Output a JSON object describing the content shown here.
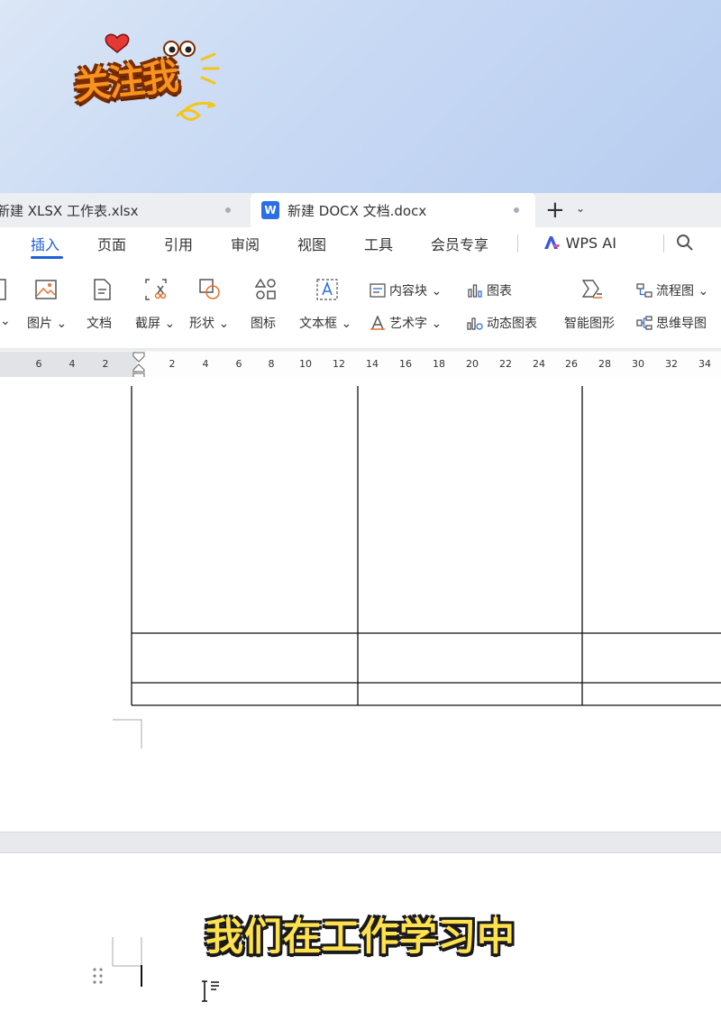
{
  "sticker": {
    "text": "关注我"
  },
  "tabs": [
    {
      "label": "新建 XLSX 工作表.xlsx",
      "active": false
    },
    {
      "label": "新建 DOCX 文档.docx",
      "active": true,
      "icon": "word-icon",
      "icon_text": "W"
    }
  ],
  "tab_actions": {
    "new_tab": "+",
    "more": "⌄"
  },
  "menu": {
    "items": [
      "插入",
      "页面",
      "引用",
      "审阅",
      "视图",
      "工具",
      "会员专享"
    ],
    "active_index": 0,
    "ai_label": "WPS AI",
    "accent_color": "#1f5fd8"
  },
  "ribbon": {
    "big_buttons": [
      {
        "label": "图片",
        "icon": "picture-icon",
        "dropdown": true
      },
      {
        "label": "文档",
        "icon": "document-icon",
        "dropdown": false
      },
      {
        "label": "截屏",
        "icon": "screenshot-icon",
        "dropdown": true
      },
      {
        "label": "形状",
        "icon": "shapes-icon",
        "dropdown": true
      },
      {
        "label": "图标",
        "icon": "icons-icon",
        "dropdown": false
      },
      {
        "label": "文本框",
        "icon": "textbox-icon",
        "dropdown": true
      }
    ],
    "small_buttons": [
      {
        "label": "内容块",
        "icon": "content-block-icon",
        "dropdown": true
      },
      {
        "label": "艺术字",
        "icon": "wordart-icon",
        "dropdown": true
      },
      {
        "label": "图表",
        "icon": "chart-icon",
        "dropdown": false
      },
      {
        "label": "动态图表",
        "icon": "dynamic-chart-icon",
        "dropdown": false
      },
      {
        "label": "智能图形",
        "icon": "smartart-icon",
        "dropdown": false
      },
      {
        "label": "流程图",
        "icon": "flowchart-icon",
        "dropdown": true
      },
      {
        "label": "思维导图",
        "icon": "mindmap-icon",
        "dropdown": false
      }
    ]
  },
  "ruler": {
    "left_ticks": [
      "6",
      "4",
      "2"
    ],
    "right_ticks": [
      "2",
      "4",
      "6",
      "8",
      "10",
      "12",
      "14",
      "16",
      "18",
      "20",
      "22",
      "24",
      "26",
      "28",
      "30",
      "32",
      "34"
    ]
  },
  "caption": "我们在工作学习中"
}
